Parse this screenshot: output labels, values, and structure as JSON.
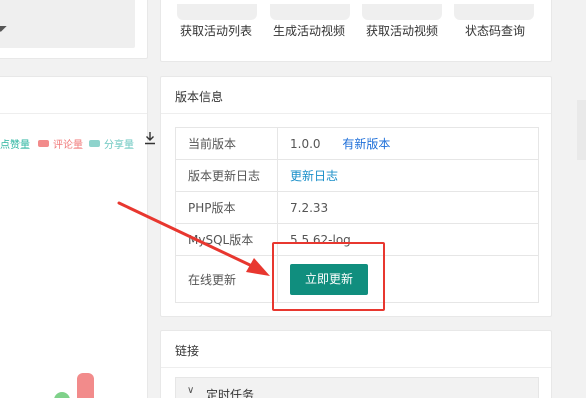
{
  "features": [
    {
      "label": "获取活动列表",
      "icon": "activity-list-icon"
    },
    {
      "label": "生成活动视频",
      "icon": "generate-video-icon"
    },
    {
      "label": "获取活动视频",
      "icon": "get-video-icon"
    },
    {
      "label": "状态码查询",
      "icon": "status-code-icon"
    }
  ],
  "chart_panel": {
    "legend": [
      "点赞量",
      "评论量",
      "分享量"
    ],
    "colors": {
      "like": "#3dbfa8",
      "comment": "#f28b8b",
      "share": "#8ed3cc",
      "green_bar": "#7fd18a"
    }
  },
  "version_info": {
    "title": "版本信息",
    "rows": {
      "current_version": {
        "label": "当前版本",
        "value": "1.0.0",
        "link": "有新版本"
      },
      "update_log": {
        "label": "版本更新日志",
        "link": "更新日志"
      },
      "php": {
        "label": "PHP版本",
        "value": "7.2.33"
      },
      "mysql": {
        "label": "MySQL版本",
        "value": "5.5.62-log"
      },
      "online_update": {
        "label": "在线更新",
        "button": "立即更新"
      }
    },
    "colors": {
      "button": "#108e7e",
      "link": "#1e6fd9",
      "annotation": "#e8372f"
    }
  },
  "links_panel": {
    "title": "链接",
    "items": [
      {
        "label": "定时任务"
      }
    ]
  }
}
